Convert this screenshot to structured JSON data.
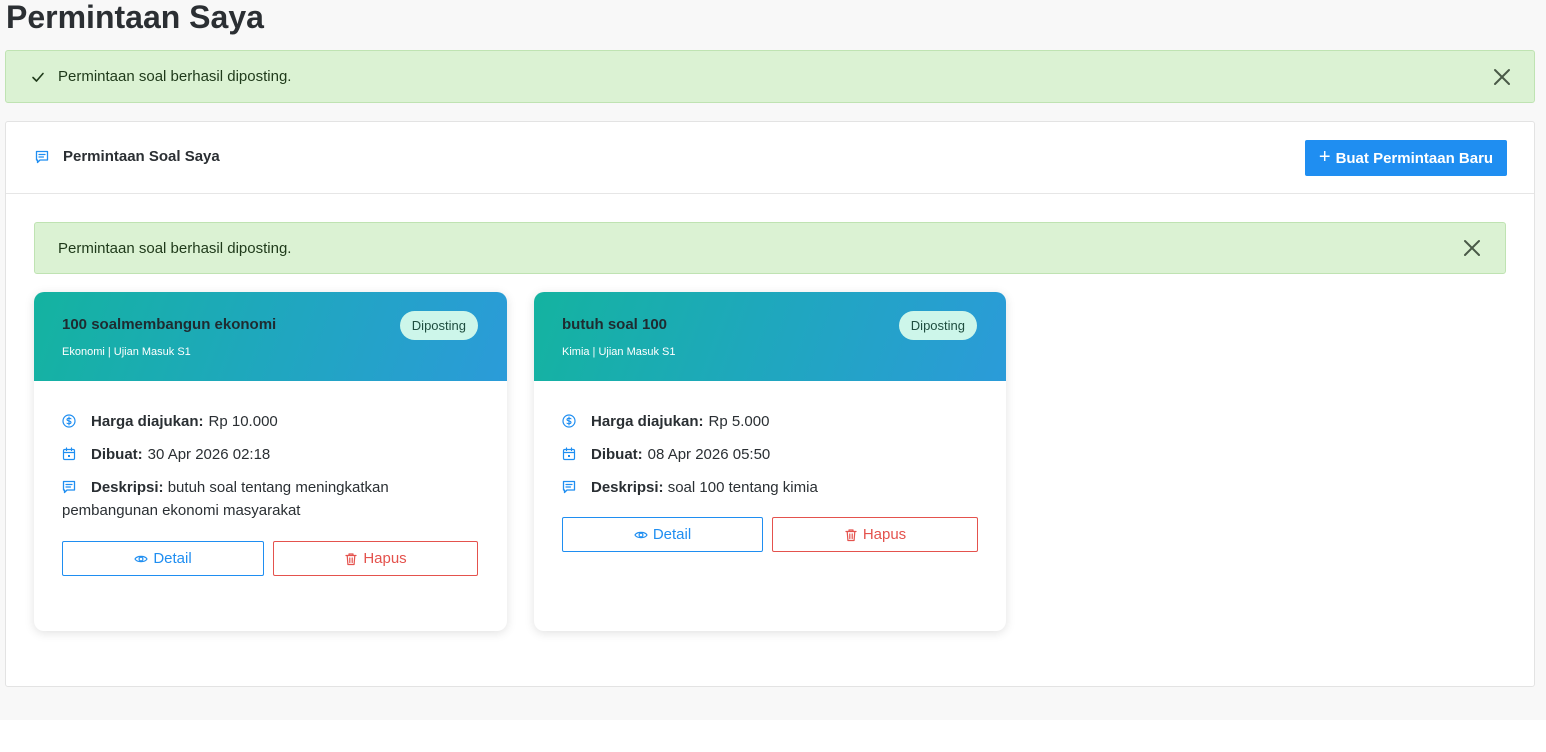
{
  "page": {
    "title": "Permintaan Saya"
  },
  "alerts": {
    "top": {
      "message": "Permintaan soal berhasil diposting."
    },
    "inner": {
      "message": "Permintaan soal berhasil diposting."
    }
  },
  "panel": {
    "title": "Permintaan Soal Saya",
    "new_button_label": "Buat Permintaan Baru",
    "new_button_icon": "+"
  },
  "labels": {
    "price": "Harga diajukan:",
    "created": "Dibuat:",
    "description": "Deskripsi:",
    "detail_button": "Detail",
    "delete_button": "Hapus"
  },
  "requests": [
    {
      "title": "100 soalmembangun ekonomi",
      "subtitle": "Ekonomi | Ujian Masuk S1",
      "status": "Diposting",
      "price": "Rp 10.000",
      "created": "30 Apr 2026 02:18",
      "description": "butuh soal tentang meningkatkan pembangunan ekonomi masyarakat"
    },
    {
      "title": "butuh soal 100",
      "subtitle": "Kimia | Ujian Masuk S1",
      "status": "Diposting",
      "price": "Rp 5.000",
      "created": "08 Apr 2026 05:50",
      "description": "soal 100 tentang kimia"
    }
  ],
  "colors": {
    "primary": "#1f8ef1",
    "danger": "#e4524d",
    "success_bg": "#dbf2d3",
    "badge_bg": "#cdf6ea",
    "card_gradient_start": "#14b3a0",
    "card_gradient_end": "#2b9bd9"
  }
}
